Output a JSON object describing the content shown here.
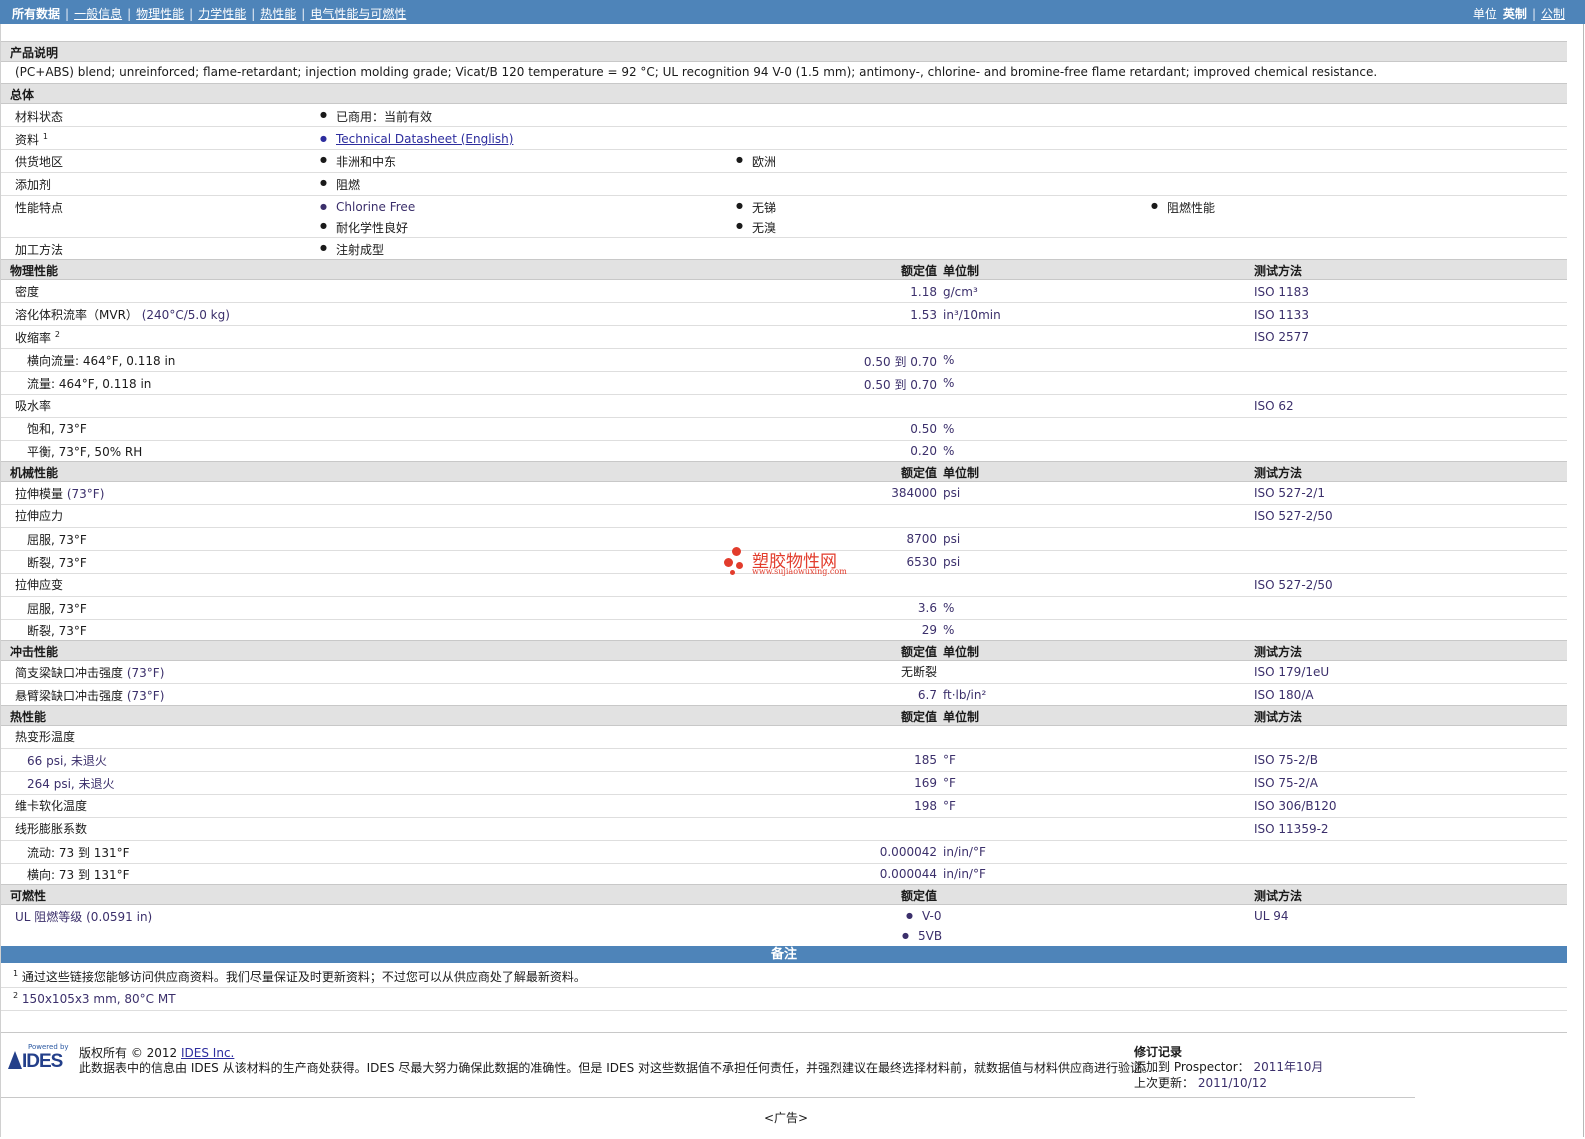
{
  "nav": {
    "items": [
      "所有数据",
      "一般信息",
      "物理性能",
      "力学性能",
      "热性能",
      "电气性能与可燃性"
    ],
    "units_label": "单位",
    "unit_english": "英制",
    "unit_metric": "公制"
  },
  "product": {
    "heading": "产品说明",
    "description": "(PC+ABS) blend; unreinforced; flame-retardant; injection molding grade; Vicat/B 120 temperature = 92 °C; UL recognition 94 V-0 (1.5 mm); antimony-, chlorine- and bromine-free flame retardant; improved chemical resistance."
  },
  "general": {
    "heading": "总体",
    "status_label": "材料状态",
    "status_value": "已商用：当前有效",
    "docs_label": "资料",
    "docs_sup": "1",
    "docs_link": "Technical Datasheet (English)",
    "region_label": "供货地区",
    "region_1": "非洲和中东",
    "region_2": "欧洲",
    "additive_label": "添加剂",
    "additive_value": "阻燃",
    "features_label": "性能特点",
    "feature_1": "Chlorine Free",
    "feature_2": "无锑",
    "feature_3": "阻燃性能",
    "feature_4": "耐化学性良好",
    "feature_5": "无溴",
    "processing_label": "加工方法",
    "processing_value": "注射成型"
  },
  "headers": {
    "nominal": "额定值",
    "unit": "单位制",
    "test": "测试方法"
  },
  "physical": {
    "heading": "物理性能",
    "density_label": "密度",
    "density_value": "1.18",
    "density_unit": "g/cm³",
    "density_test": "ISO 1183",
    "mvr_label": "溶化体积流率（MVR）",
    "mvr_cond": "(240°C/5.0 kg)",
    "mvr_value": "1.53",
    "mvr_unit": "in³/10min",
    "mvr_test": "ISO 1133",
    "shrink_label": "收缩率",
    "shrink_sup": "2",
    "shrink_test": "ISO 2577",
    "shrink_cross_label": "横向流量: 464°F, 0.118 in",
    "shrink_cross_value": "0.50 到  0.70",
    "shrink_cross_unit": "%",
    "shrink_flow_label": "流量: 464°F, 0.118 in",
    "shrink_flow_value": "0.50 到  0.70",
    "shrink_flow_unit": "%",
    "water_label": "吸水率",
    "water_test": "ISO 62",
    "water_sat_label": "饱和, 73°F",
    "water_sat_value": "0.50",
    "water_sat_unit": "%",
    "water_eq_label": "平衡, 73°F, 50% RH",
    "water_eq_value": "0.20",
    "water_eq_unit": "%"
  },
  "mechanical": {
    "heading": "机械性能",
    "tmod_label": "拉伸模量",
    "tmod_cond": "(73°F)",
    "tmod_value": "384000",
    "tmod_unit": "psi",
    "tmod_test": "ISO 527-2/1",
    "tstress_label": "拉伸应力",
    "tstress_test": "ISO 527-2/50",
    "tstress_yield_label": "屈服, 73°F",
    "tstress_yield_value": "8700",
    "tstress_yield_unit": "psi",
    "tstress_break_label": "断裂, 73°F",
    "tstress_break_value": "6530",
    "tstress_break_unit": "psi",
    "tstrain_label": "拉伸应变",
    "tstrain_test": "ISO 527-2/50",
    "tstrain_yield_label": "屈服, 73°F",
    "tstrain_yield_value": "3.6",
    "tstrain_yield_unit": "%",
    "tstrain_break_label": "断裂, 73°F",
    "tstrain_break_value": "29",
    "tstrain_break_unit": "%"
  },
  "impact": {
    "heading": "冲击性能",
    "charpy_label": "简支梁缺口冲击强度",
    "charpy_cond": "(73°F)",
    "charpy_value": "无断裂",
    "charpy_test": "ISO 179/1eU",
    "izod_label": "悬臂梁缺口冲击强度",
    "izod_cond": "(73°F)",
    "izod_value": "6.7",
    "izod_unit": "ft·lb/in²",
    "izod_test": "ISO 180/A"
  },
  "thermal": {
    "heading": "热性能",
    "hdt_label": "热变形温度",
    "hdt66_label": "66 psi, 未退火",
    "hdt66_value": "185",
    "hdt66_unit": "°F",
    "hdt66_test": "ISO 75-2/B",
    "hdt264_label": "264 psi, 未退火",
    "hdt264_value": "169",
    "hdt264_unit": "°F",
    "hdt264_test": "ISO 75-2/A",
    "vicat_label": "维卡软化温度",
    "vicat_value": "198",
    "vicat_unit": "°F",
    "vicat_test": "ISO 306/B120",
    "clte_label": "线形膨胀系数",
    "clte_test": "ISO 11359-2",
    "clte_flow_label": "流动: 73 到  131°F",
    "clte_flow_value": "0.000042",
    "clte_flow_unit": "in/in/°F",
    "clte_cross_label": "横向: 73 到  131°F",
    "clte_cross_value": "0.000044",
    "clte_cross_unit": "in/in/°F"
  },
  "flammability": {
    "heading": "可燃性",
    "ul_label": "UL 阻燃等级",
    "ul_cond": "(0.0591 in)",
    "ul_value_1": "V-0",
    "ul_value_2": "5VB",
    "ul_test": "UL 94"
  },
  "notes": {
    "heading": "备注",
    "note1_sup": "1",
    "note1": "通过这些链接您能够访问供应商资料。我们尽量保证及时更新资料；不过您可以从供应商处了解最新资料。",
    "note2_sup": "2",
    "note2": "150x105x3 mm, 80°C MT"
  },
  "footer": {
    "powered_by": "Powered by",
    "logo_name": "IDES",
    "copyright": "版权所有 © 2012",
    "ides_link": "IDES Inc.",
    "disclaimer": "此数据表中的信息由 IDES 从该材料的生产商处获得。IDES 尽最大努力确保此数据的准确性。但是 IDES 对这些数据值不承担任何责任，并强烈建议在最终选择材料前，就数据值与材料供应商进行验证。",
    "rev_heading": "修订记录",
    "added_label": "添加到 Prospector：",
    "added_value": "2011年10月",
    "updated_label": "上次更新：",
    "updated_value": "2011/10/12",
    "ad": "<广告>"
  },
  "watermark": {
    "cn": "塑胶物性网",
    "url": "www.sujiaowuxing.com"
  }
}
